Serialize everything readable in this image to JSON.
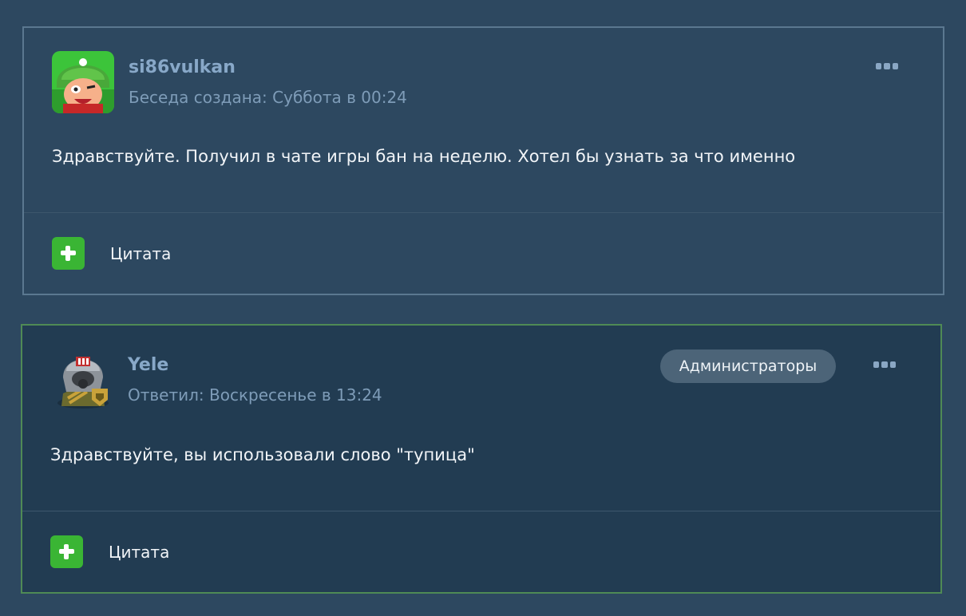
{
  "posts": [
    {
      "username": "si86vulkan",
      "meta": "Беседа создана: Суббота в 00:24",
      "body": "Здравствуйте. Получил в чате игры бан на неделю. Хотел бы узнать за что именно",
      "quote_label": "Цитата",
      "role": null
    },
    {
      "username": "Yele",
      "meta": "Ответил: Воскресенье в 13:24",
      "body": "Здравствуйте, вы использовали слово \"тупица\"",
      "quote_label": "Цитата",
      "role": "Администраторы"
    }
  ],
  "icons": {
    "more": "more-dots-icon",
    "quote": "plus-icon"
  },
  "colors": {
    "page_bg": "#2d4860",
    "admin_bg": "#223c52",
    "admin_border": "#4f8a55",
    "username": "#88a8c8",
    "quote_button": "#3ab534"
  }
}
